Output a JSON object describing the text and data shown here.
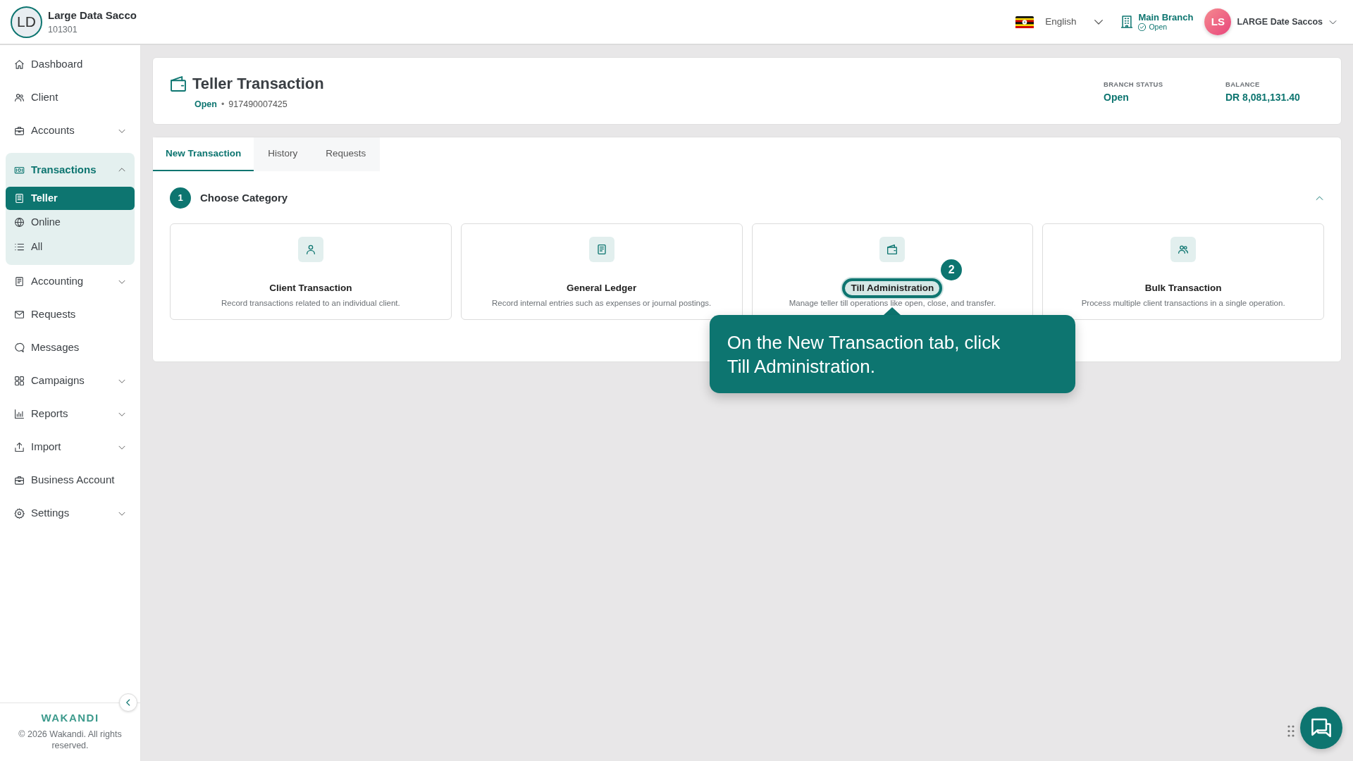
{
  "org": {
    "initials": "LD",
    "name": "Large Data Sacco",
    "code": "101301"
  },
  "topbar": {
    "language": "English",
    "branch": {
      "name": "Main Branch",
      "status": "Open"
    },
    "user": {
      "initials": "LS",
      "name": "LARGE Date Saccos"
    }
  },
  "sidebar": {
    "items": [
      {
        "label": "Dashboard",
        "kind": "link",
        "selected": false
      },
      {
        "label": "Client",
        "kind": "link",
        "selected": false
      },
      {
        "label": "Accounts",
        "kind": "group",
        "selected": false,
        "expanded": false
      },
      {
        "label": "Transactions",
        "kind": "group",
        "selected": true,
        "expanded": true,
        "children": [
          {
            "label": "Teller",
            "selected": true
          },
          {
            "label": "Online",
            "selected": false
          },
          {
            "label": "All",
            "selected": false
          }
        ]
      },
      {
        "label": "Accounting",
        "kind": "group",
        "selected": false,
        "expanded": false
      },
      {
        "label": "Requests",
        "kind": "link",
        "selected": false
      },
      {
        "label": "Messages",
        "kind": "link",
        "selected": false
      },
      {
        "label": "Campaigns",
        "kind": "group",
        "selected": false,
        "expanded": false
      },
      {
        "label": "Reports",
        "kind": "group",
        "selected": false,
        "expanded": false
      },
      {
        "label": "Import",
        "kind": "group",
        "selected": false,
        "expanded": false
      },
      {
        "label": "Business Account",
        "kind": "link",
        "selected": false
      },
      {
        "label": "Settings",
        "kind": "group",
        "selected": false,
        "expanded": false
      }
    ]
  },
  "footer": {
    "brand": "WAKANDI",
    "copyright": "© 2026 Wakandi. All rights reserved."
  },
  "page": {
    "title": "Teller Transaction",
    "status": "Open",
    "separator": "•",
    "number": "917490007425",
    "stats": [
      {
        "label": "BRANCH STATUS",
        "value": "Open"
      },
      {
        "label": "BALANCE",
        "value": "DR 8,081,131.40"
      }
    ]
  },
  "tabs": [
    {
      "label": "New Transaction",
      "selected": true
    },
    {
      "label": "History",
      "selected": false
    },
    {
      "label": "Requests",
      "selected": false
    }
  ],
  "step": {
    "number": "1",
    "title": "Choose Category",
    "expanded": true
  },
  "categories": [
    {
      "title": "Client Transaction",
      "description": "Record transactions related to an individual client.",
      "highlighted": false
    },
    {
      "title": "General Ledger",
      "description": "Record internal entries such as expenses or journal postings.",
      "highlighted": false
    },
    {
      "title": "Till Administration",
      "description": "Manage teller till operations like open, close, and transfer.",
      "highlighted": true
    },
    {
      "title": "Bulk Transaction",
      "description": "Process multiple client transactions in a single operation.",
      "highlighted": false
    }
  ],
  "tour": {
    "step": "2",
    "text": "On the New Transaction tab, click Till Administration."
  }
}
